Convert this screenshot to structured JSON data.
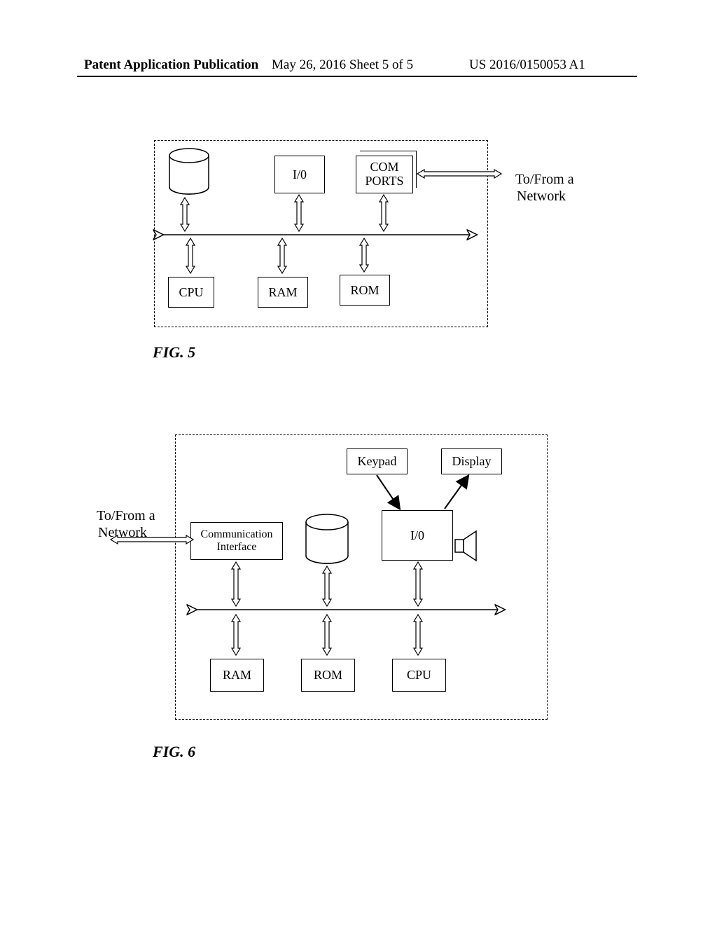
{
  "header": {
    "left": "Patent Application Publication",
    "center": "May 26, 2016  Sheet 5 of 5",
    "right": "US 2016/0150053 A1"
  },
  "fig5": {
    "caption": "FIG. 5",
    "io": "I/0",
    "com": "COM\nPORTS",
    "cpu": "CPU",
    "ram": "RAM",
    "rom": "ROM",
    "network": "To/From a\nNetwork"
  },
  "fig6": {
    "caption": "FIG. 6",
    "network": "To/From a\nNetwork",
    "comm": "Communication\nInterface",
    "io": "I/0",
    "keypad": "Keypad",
    "display": "Display",
    "ram": "RAM",
    "rom": "ROM",
    "cpu": "CPU"
  }
}
